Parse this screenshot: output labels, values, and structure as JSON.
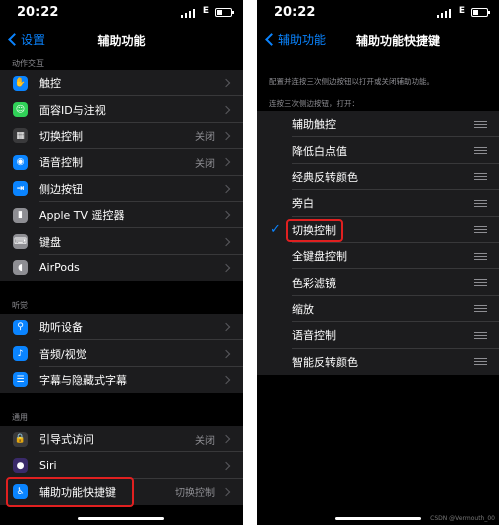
{
  "left": {
    "status": {
      "time": "20:22",
      "network": "E"
    },
    "nav": {
      "back_label": "设置",
      "title": "辅助功能"
    },
    "sections": [
      {
        "header": "动作交互",
        "items": [
          {
            "label": "触控",
            "value": "",
            "icon": "touch-icon",
            "color": "#0a84ff",
            "glyph": "✋"
          },
          {
            "label": "面容ID与注视",
            "value": "",
            "icon": "face-id-icon",
            "color": "#30d158",
            "glyph": "☺"
          },
          {
            "label": "切换控制",
            "value": "关闭",
            "icon": "switch-control-icon",
            "color": "#3a3a3c",
            "glyph": "▦"
          },
          {
            "label": "语音控制",
            "value": "关闭",
            "icon": "voice-control-icon",
            "color": "#0a84ff",
            "glyph": "◉"
          },
          {
            "label": "侧边按钮",
            "value": "",
            "icon": "side-button-icon",
            "color": "#0a84ff",
            "glyph": "⇥"
          },
          {
            "label": "Apple TV 遥控器",
            "value": "",
            "icon": "remote-icon",
            "color": "#8e8e93",
            "glyph": "▮"
          },
          {
            "label": "键盘",
            "value": "",
            "icon": "keyboard-icon",
            "color": "#8e8e93",
            "glyph": "⌨"
          },
          {
            "label": "AirPods",
            "value": "",
            "icon": "airpods-icon",
            "color": "#8e8e93",
            "glyph": "◖"
          }
        ]
      },
      {
        "header": "听觉",
        "items": [
          {
            "label": "助听设备",
            "value": "",
            "icon": "hearing-icon",
            "color": "#0a84ff",
            "glyph": "⚲"
          },
          {
            "label": "音频/视觉",
            "value": "",
            "icon": "audio-visual-icon",
            "color": "#0a84ff",
            "glyph": "♪"
          },
          {
            "label": "字幕与隐藏式字幕",
            "value": "",
            "icon": "subtitles-icon",
            "color": "#0a84ff",
            "glyph": "☰"
          }
        ]
      },
      {
        "header": "通用",
        "items": [
          {
            "label": "引导式访问",
            "value": "关闭",
            "icon": "lock-icon",
            "color": "#3a3a3c",
            "glyph": "🔒"
          },
          {
            "label": "Siri",
            "value": "",
            "icon": "siri-icon",
            "color": "#3a2a6a",
            "glyph": "●"
          },
          {
            "label": "辅助功能快捷键",
            "value": "切换控制",
            "icon": "accessibility-icon",
            "color": "#0a84ff",
            "glyph": "♿"
          }
        ]
      }
    ]
  },
  "right": {
    "status": {
      "time": "20:22",
      "network": "E"
    },
    "nav": {
      "back_label": "辅助功能",
      "title": "辅助功能快捷键"
    },
    "description": "配置并连按三次侧边按钮以打开或关闭辅助功能。",
    "subheader": "连按三次侧边按钮，打开：",
    "items": [
      {
        "label": "辅助触控",
        "checked": false
      },
      {
        "label": "降低白点值",
        "checked": false
      },
      {
        "label": "经典反转颜色",
        "checked": false
      },
      {
        "label": "旁白",
        "checked": false
      },
      {
        "label": "切换控制",
        "checked": true
      },
      {
        "label": "全键盘控制",
        "checked": false
      },
      {
        "label": "色彩滤镜",
        "checked": false
      },
      {
        "label": "缩放",
        "checked": false
      },
      {
        "label": "语音控制",
        "checked": false
      },
      {
        "label": "智能反转颜色",
        "checked": false
      }
    ]
  },
  "watermark": "CSDN @Vermouth_00"
}
